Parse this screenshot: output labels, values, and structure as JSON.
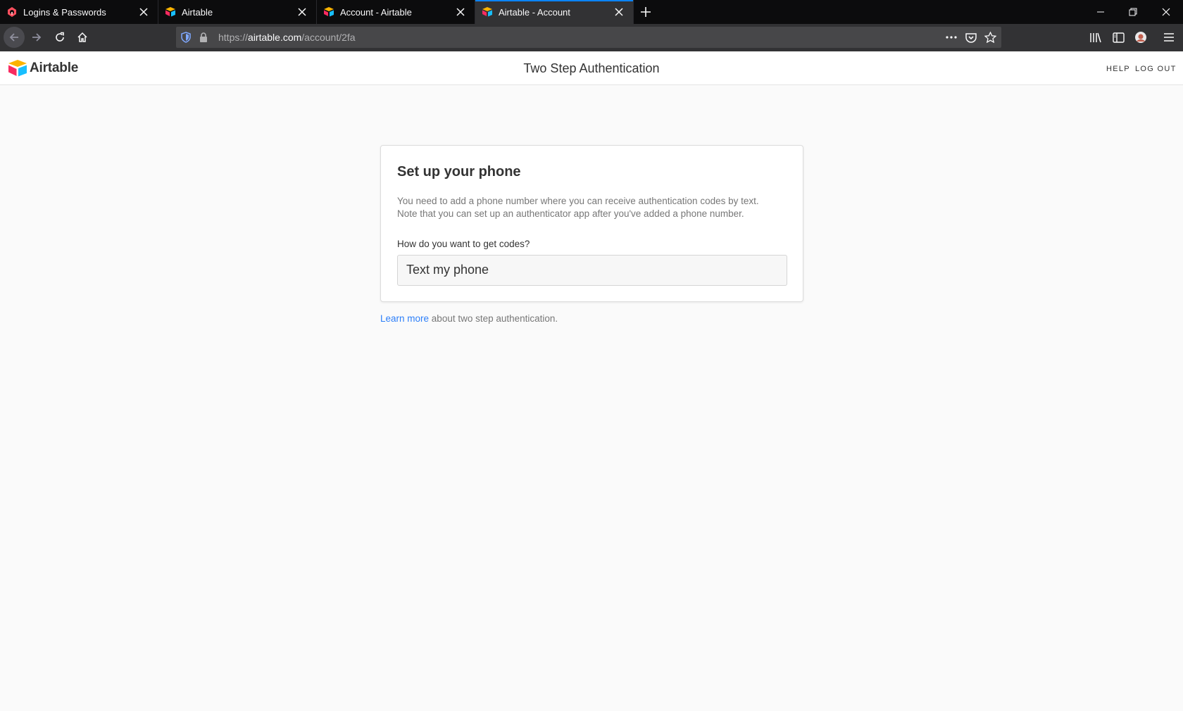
{
  "browser": {
    "tabs": [
      {
        "title": "Logins & Passwords",
        "icon": "lockwise-icon",
        "active": false
      },
      {
        "title": "Airtable",
        "icon": "airtable-favicon",
        "active": false
      },
      {
        "title": "Account - Airtable",
        "icon": "airtable-favicon",
        "active": false
      },
      {
        "title": "Airtable - Account",
        "icon": "airtable-favicon",
        "active": true
      }
    ],
    "url": {
      "scheme": "https://",
      "host": "airtable.com",
      "path": "/account/2fa"
    }
  },
  "header": {
    "logo_text": "Airtable",
    "title": "Two Step Authentication",
    "help_label": "HELP",
    "logout_label": "LOG OUT"
  },
  "card": {
    "title": "Set up your phone",
    "description_line1": "You need to add a phone number where you can receive authentication codes by text.",
    "description_line2": "Note that you can set up an authenticator app after you've added a phone number.",
    "field_label": "How do you want to get codes?",
    "selected_option": "Text my phone"
  },
  "footnote": {
    "link_text": "Learn more",
    "rest": " about two step authentication."
  },
  "colors": {
    "accent_blue": "#2d7ff9",
    "tab_indicator": "#0a84ff",
    "chrome_bg": "#0c0c0d",
    "page_bg": "#fafafa"
  }
}
